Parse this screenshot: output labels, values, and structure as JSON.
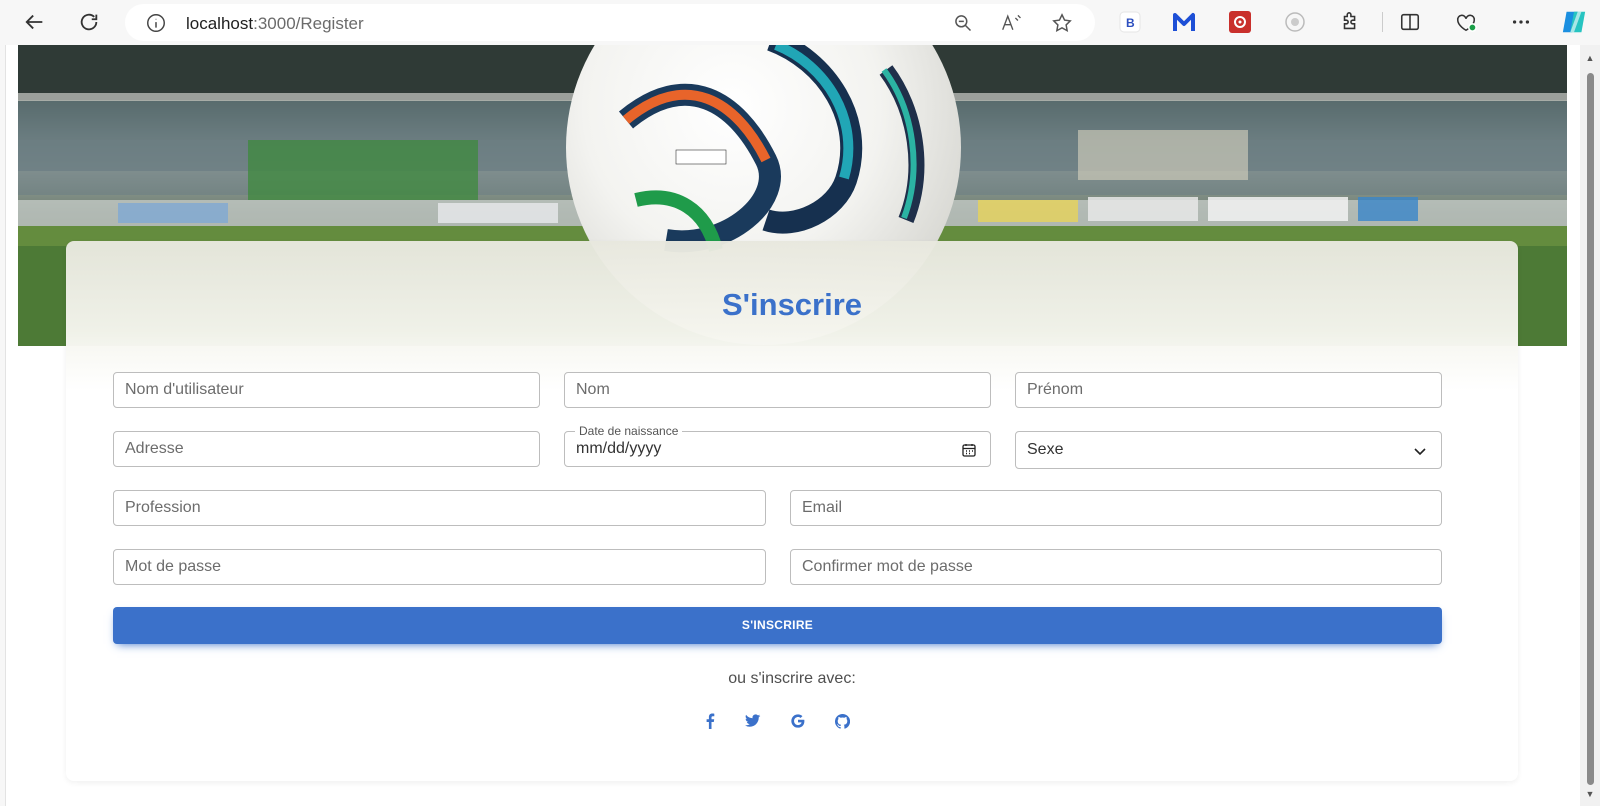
{
  "browser": {
    "url_host": "localhost",
    "url_path": ":3000/Register"
  },
  "page": {
    "title": "S'inscrire",
    "fields": {
      "username_placeholder": "Nom d'utilisateur",
      "lastname_placeholder": "Nom",
      "firstname_placeholder": "Prénom",
      "address_placeholder": "Adresse",
      "birthdate_label": "Date de naissance",
      "birthdate_value": "mm/dd/yyyy",
      "sex_value": "Sexe",
      "profession_placeholder": "Profession",
      "email_placeholder": "Email",
      "password_placeholder": "Mot de passe",
      "confirm_password_placeholder": "Confirmer mot de passe"
    },
    "submit_label": "S'INSCRIRE",
    "alt_text": "ou s'inscrire avec:",
    "social": [
      "facebook-icon",
      "twitter-icon",
      "google-icon",
      "github-icon"
    ],
    "colors": {
      "accent": "#3b71ca"
    }
  }
}
